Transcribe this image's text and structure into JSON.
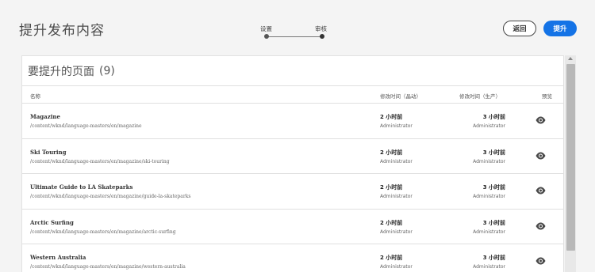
{
  "header": {
    "title": "提升发布内容",
    "steps": [
      {
        "label": "设置"
      },
      {
        "label": "审核"
      }
    ],
    "back_label": "返回",
    "promote_label": "提升"
  },
  "panel": {
    "title": "要提升的页面",
    "count": "(9)",
    "columns": {
      "name": "名称",
      "modified_authoring": "修改时间（晶动）",
      "modified_publish": "修改时间（生产）",
      "preview": "预览"
    },
    "rows": [
      {
        "title": "Magazine",
        "path": "/content/wknd/language-masters/en/magazine",
        "mod_time": "2 小时前",
        "mod_user": "Administrator",
        "pub_time": "3 小时前",
        "pub_user": "Administrator"
      },
      {
        "title": "Ski Touring",
        "path": "/content/wknd/language-masters/en/magazine/ski-touring",
        "mod_time": "2 小时前",
        "mod_user": "Administrator",
        "pub_time": "3 小时前",
        "pub_user": "Administrator"
      },
      {
        "title": "Ultimate Guide to LA Skateparks",
        "path": "/content/wknd/language-masters/en/magazine/guide-la-skateparks",
        "mod_time": "2 小时前",
        "mod_user": "Administrator",
        "pub_time": "3 小时前",
        "pub_user": "Administrator"
      },
      {
        "title": "Arctic Surfing",
        "path": "/content/wknd/language-masters/en/magazine/arctic-surfing",
        "mod_time": "2 小时前",
        "mod_user": "Administrator",
        "pub_time": "3 小时前",
        "pub_user": "Administrator"
      },
      {
        "title": "Western Australia",
        "path": "/content/wknd/language-masters/en/magazine/western-australia",
        "mod_time": "2 小时前",
        "mod_user": "Administrator",
        "pub_time": "3 小时前",
        "pub_user": "Administrator"
      }
    ]
  },
  "colors": {
    "accent": "#1473e6",
    "background": "#f4f4f4"
  },
  "icons": {
    "preview": "eye-icon"
  }
}
